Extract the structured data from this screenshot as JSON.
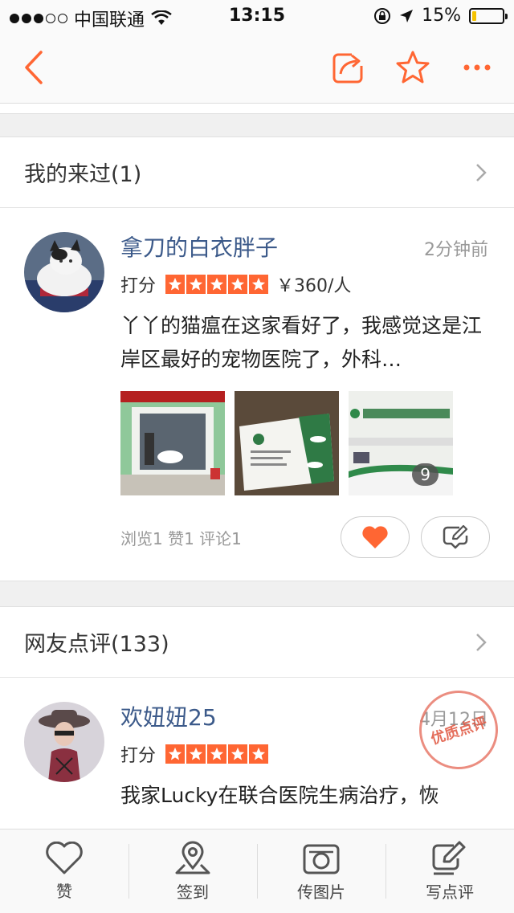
{
  "status_bar": {
    "carrier": "中国联通",
    "time": "13:15",
    "battery": "15%",
    "battery_level": 0.15
  },
  "nav": {
    "icons": [
      "back-icon",
      "share-icon",
      "star-icon",
      "more-icon"
    ],
    "accent_color": "#ff6633"
  },
  "my_visits": {
    "title": "我的来过(1)"
  },
  "my_review": {
    "name": "拿刀的白衣胖子",
    "time": "2分钟前",
    "rating_label": "打分",
    "stars": 5,
    "price": "￥360/人",
    "text": "丫丫的猫瘟在这家看好了，我感觉这是江岸区最好的宠物医院了，外科…",
    "photo_count": "9",
    "stats": "浏览1  赞1  评论1"
  },
  "netizen_reviews": {
    "title": "网友点评(133)"
  },
  "second_review": {
    "name": "欢妞妞25",
    "time": "4月12日",
    "rating_label": "打分",
    "stars": 5,
    "text": "我家Lucky在联合医院生病治疗，恢",
    "stamp": "优质点评"
  },
  "tabbar": {
    "items": [
      {
        "label": "赞",
        "icon": "heart-icon"
      },
      {
        "label": "签到",
        "icon": "location-pin-icon"
      },
      {
        "label": "传图片",
        "icon": "camera-icon"
      },
      {
        "label": "写点评",
        "icon": "edit-icon"
      }
    ]
  }
}
